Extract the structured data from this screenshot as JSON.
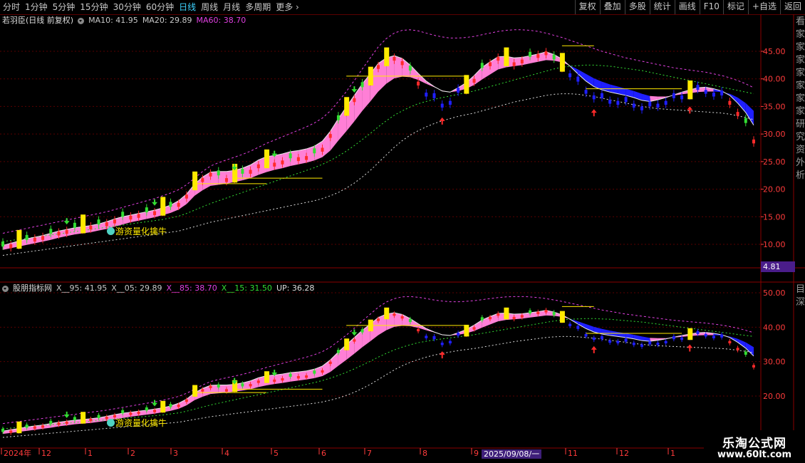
{
  "toolbar": {
    "periods": [
      "分时",
      "1分钟",
      "5分钟",
      "15分钟",
      "30分钟",
      "60分钟",
      "日线",
      "周线",
      "月线",
      "多周期",
      "更多"
    ],
    "active_period": "日线",
    "actions": [
      "复权",
      "叠加",
      "多股",
      "统计",
      "画线",
      "F10",
      "标记",
      "+自选",
      "返回"
    ]
  },
  "main_panel": {
    "stock": "若羽臣(日线 前复权)",
    "ma10": "MA10: 41.95",
    "ma20": "MA20: 29.89",
    "ma60": "MA60: 38.70",
    "ma10_color": "#c8c8c8",
    "ma20_color": "#c8c8c8",
    "ma60_color": "#e040e0",
    "y_ticks": [
      "45.00",
      "40.00",
      "35.00",
      "30.00",
      "25.00",
      "20.00",
      "15.00",
      "10.00"
    ],
    "y_values": [
      45,
      40,
      35,
      30,
      25,
      20,
      15,
      10
    ],
    "price_tag": "4.81",
    "signal_text": "游资量化擒牛"
  },
  "sub_panel": {
    "name": "股朋指标网",
    "x95": "X__95: 41.95",
    "x05": "X__05: 29.89",
    "x85": "X__85: 38.70",
    "x15": "X__15: 31.50",
    "up": "UP: 36.28",
    "x85_color": "#e040e0",
    "x15_color": "#33dd33",
    "y_ticks": [
      "50.00",
      "40.00",
      "30.00",
      "20.00"
    ],
    "y_values": [
      50,
      40,
      30,
      20
    ],
    "signal_text": "游资量化擒牛"
  },
  "date_axis": {
    "labels": [
      "2024年",
      "12",
      "1",
      "2",
      "3",
      "4",
      "5",
      "6",
      "7",
      "8",
      "9",
      "2025/09/08/一",
      "11",
      "12",
      "1"
    ],
    "highlight": "2025/09/08/一"
  },
  "sidebar_text_top": "看家家家家家家家研究资外析",
  "sidebar_text_bottom": "目深",
  "logo": {
    "line1": "乐淘公式网",
    "line2": "www.60lt.com"
  },
  "colors": {
    "up": "#ff2a2a",
    "down": "#33dd33",
    "yellow": "#ffea00",
    "pink": "#ff7fd6",
    "blue": "#1f1fff",
    "axis": "#ff3b3b",
    "grid": "#5a0000"
  },
  "series": {
    "price": [
      9.6,
      10,
      10.4,
      10.8,
      11.2,
      11.5,
      11.9,
      12.3,
      12.6,
      13,
      13.2,
      13.4,
      13.6,
      14,
      14.5,
      15,
      15.2,
      15.5,
      15.8,
      16,
      16.4,
      16.8,
      17.5,
      19,
      21,
      22,
      23,
      22.5,
      22,
      22.4,
      22.8,
      23.5,
      24.5,
      25,
      24.8,
      25.2,
      25.6,
      25.8,
      26,
      26.5,
      27.5,
      30,
      32.5,
      34.5,
      36.5,
      38.5,
      40,
      42.5,
      43.5,
      44,
      43.2,
      41.5,
      39.5,
      37.5,
      36.5,
      35.5,
      36,
      37.5,
      38.5,
      40,
      42,
      43,
      44,
      43.5,
      43,
      43.5,
      44,
      44.5,
      45,
      43.5,
      42.5,
      41,
      39.5,
      38,
      37,
      36.5,
      36.2,
      36,
      35.8,
      35.5,
      35,
      35,
      35.5,
      36,
      36.5,
      37,
      37.5,
      38,
      38,
      37.5,
      37,
      36,
      34,
      32,
      29
    ],
    "pink_band_lo": [
      9,
      9.3,
      9.6,
      9.9,
      10.2,
      10.5,
      10.8,
      11.2,
      11.5,
      11.8,
      12,
      12.2,
      12.5,
      12.8,
      13.2,
      13.6,
      14,
      14.3,
      14.6,
      14.9,
      15.3,
      15.7,
      16.3,
      17.3,
      18.8,
      19.8,
      20.6,
      20.8,
      21,
      21.3,
      21.6,
      22,
      22.6,
      23.1,
      23.5,
      23.8,
      24.2,
      24.5,
      24.8,
      25.2,
      25.8,
      27,
      28.8,
      30.5,
      32.3,
      34.2,
      35.9,
      37.7,
      39.1,
      40.1,
      40.4,
      40.3,
      39.8,
      39.1,
      38.5,
      37.9,
      37.6,
      37.8,
      38.2,
      38.9,
      39.9,
      40.8,
      41.7,
      42.1,
      42.3,
      42.5,
      42.8,
      43.1,
      43.4,
      43.3,
      43,
      42.4,
      41.7,
      40.9,
      40.1,
      39.5,
      39,
      38.6,
      38.2,
      37.8,
      37.3,
      36.9,
      36.8,
      36.8,
      37,
      37.2,
      37.4,
      37.6,
      37.7,
      37.7,
      37.6,
      37.3,
      36.6,
      35.6,
      34.2
    ],
    "pink_band_hi": [
      9.8,
      10.2,
      10.6,
      11,
      11.3,
      11.6,
      12,
      12.4,
      12.7,
      13,
      13.2,
      13.4,
      13.7,
      14.1,
      14.6,
      15,
      15.3,
      15.6,
      15.9,
      16.2,
      16.6,
      17.1,
      17.9,
      19.1,
      20.9,
      22.2,
      23.1,
      23.2,
      23.2,
      23.4,
      23.8,
      24.4,
      25.3,
      25.9,
      26.1,
      26.4,
      26.8,
      27,
      27.3,
      27.8,
      28.7,
      30.5,
      32.8,
      34.9,
      37,
      39.1,
      40.9,
      42.8,
      43.8,
      44.2,
      43.7,
      42.5,
      41,
      39.6,
      38.6,
      37.8,
      37.6,
      38.4,
      39.3,
      40.6,
      42.1,
      43.1,
      44,
      44.1,
      43.8,
      43.9,
      44.2,
      44.5,
      44.9,
      44.4,
      43.6,
      42.3,
      40.9,
      39.6,
      38.6,
      38,
      37.6,
      37.3,
      37,
      36.6,
      36.1,
      35.9,
      36.2,
      36.6,
      37.1,
      37.6,
      38,
      38.4,
      38.5,
      38.2,
      37.8,
      37,
      35.6,
      33.9,
      31.6
    ],
    "ma60": [
      10.5,
      10.7,
      10.9,
      11.1,
      11.3,
      11.5,
      11.7,
      11.9,
      12.1,
      12.3,
      12.5,
      12.7,
      12.9,
      13.1,
      13.3,
      13.5,
      13.7,
      13.9,
      14.1,
      14.3,
      14.5,
      14.8,
      15.1,
      15.6,
      16.2,
      16.8,
      17.4,
      17.9,
      18.4,
      18.9,
      19.4,
      19.9,
      20.4,
      20.9,
      21.4,
      21.9,
      22.4,
      22.9,
      23.4,
      23.9,
      24.5,
      25.2,
      26,
      26.9,
      27.9,
      29,
      30.1,
      31.3,
      32.4,
      33.4,
      34.2,
      34.9,
      35.5,
      35.9,
      36.3,
      36.6,
      36.9,
      37.2,
      37.5,
      37.8,
      38.2,
      38.6,
      39,
      39.4,
      39.8,
      40.2,
      40.6,
      41,
      41.4,
      41.8,
      42.1,
      42.3,
      42.4,
      42.5,
      42.5,
      42.4,
      42.3,
      42.1,
      41.9,
      41.7,
      41.5,
      41.2,
      40.9,
      40.6,
      40.3,
      40,
      39.7,
      39.4,
      39.1,
      38.8,
      38.5,
      38.2,
      37.9,
      37.6,
      37.3
    ],
    "lower": [
      8,
      8.2,
      8.4,
      8.6,
      8.8,
      9,
      9.2,
      9.4,
      9.6,
      9.8,
      10,
      10.2,
      10.4,
      10.6,
      10.8,
      11,
      11.2,
      11.4,
      11.6,
      11.8,
      12,
      12.2,
      12.4,
      12.8,
      13.2,
      13.6,
      14,
      14.3,
      14.6,
      14.9,
      15.2,
      15.5,
      15.8,
      16.1,
      16.4,
      16.7,
      17,
      17.3,
      17.6,
      17.9,
      18.3,
      18.8,
      19.4,
      20.2,
      21.1,
      22.2,
      23.4,
      24.8,
      26.2,
      27.6,
      28.8,
      29.8,
      30.6,
      31.3,
      31.9,
      32.4,
      32.8,
      33.2,
      33.5,
      33.8,
      34.2,
      34.6,
      35,
      35.4,
      35.8,
      36.1,
      36.4,
      36.7,
      37,
      37.2,
      37.3,
      37.3,
      37.2,
      37,
      36.8,
      36.5,
      36.2,
      35.9,
      35.6,
      35.3,
      35,
      34.8,
      34.6,
      34.5,
      34.4,
      34.3,
      34.2,
      34.1,
      34,
      33.9,
      33.8,
      33.6,
      33.3,
      33,
      32.6
    ],
    "upper": [
      12,
      12.3,
      12.6,
      12.9,
      13.2,
      13.5,
      13.8,
      14.1,
      14.4,
      14.7,
      15,
      15.3,
      15.6,
      15.9,
      16.3,
      16.7,
      17.1,
      17.5,
      17.9,
      18.3,
      18.8,
      19.3,
      19.9,
      20.8,
      22,
      23.2,
      24.2,
      24.8,
      25.3,
      25.8,
      26.3,
      26.9,
      27.6,
      28.3,
      28.9,
      29.5,
      30.1,
      30.7,
      31.3,
      32,
      32.9,
      34.2,
      35.9,
      37.7,
      39.7,
      41.8,
      43.8,
      45.8,
      47.3,
      48.3,
      48.8,
      48.9,
      48.7,
      48.3,
      47.9,
      47.6,
      47.4,
      47.4,
      47.5,
      47.7,
      48,
      48.3,
      48.6,
      48.8,
      48.9,
      48.9,
      48.8,
      48.6,
      48.3,
      47.9,
      47.5,
      47,
      46.5,
      46,
      45.5,
      45,
      44.6,
      44.2,
      43.8,
      43.5,
      43.2,
      42.9,
      42.6,
      42.3,
      42,
      41.8,
      41.6,
      41.4,
      41.2,
      40.9,
      40.6,
      40.2,
      39.7,
      39.1,
      38.4
    ]
  }
}
